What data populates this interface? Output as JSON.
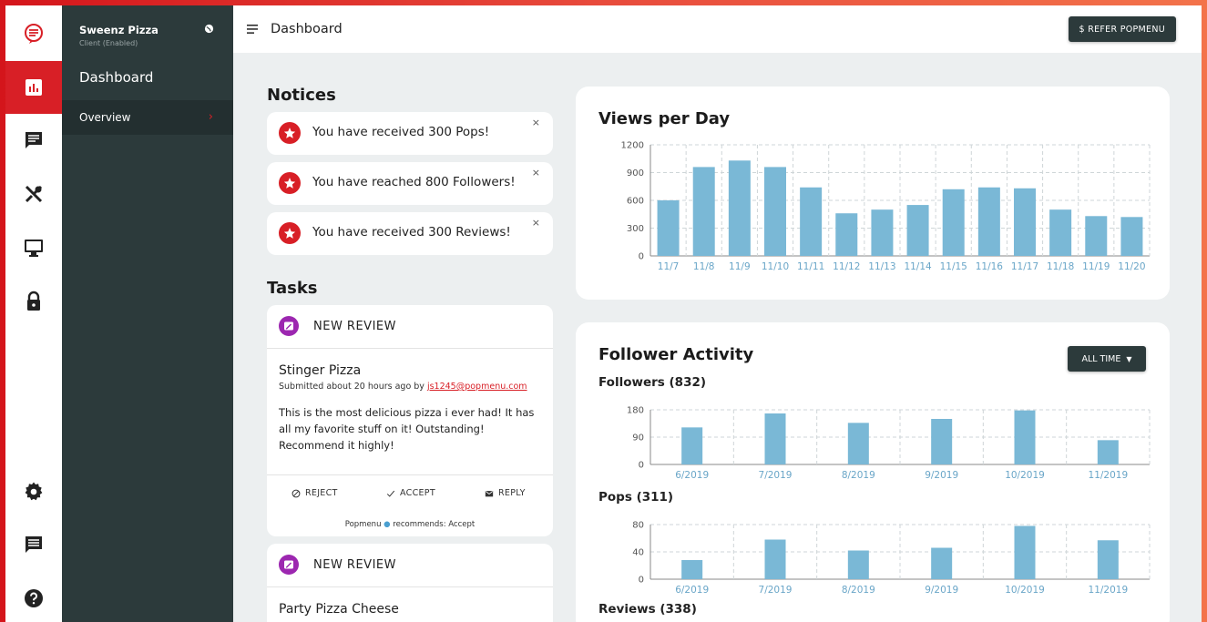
{
  "app": {
    "client_name": "Sweenz Pizza",
    "client_status": "Client (Enabled)",
    "nav_dashboard": "Dashboard",
    "nav_overview": "Overview",
    "page_title": "Dashboard",
    "refer_button": "$ REFER POPMENU"
  },
  "rail_icons": [
    "chat-bubble-logo-icon",
    "bar-chart-icon",
    "message-icon",
    "utensils-icon",
    "monitor-icon",
    "lock-icon",
    "gear-icon",
    "feedback-icon",
    "help-icon"
  ],
  "notices": {
    "heading": "Notices",
    "items": [
      {
        "text": "You have received 300 Pops!",
        "close": "×"
      },
      {
        "text": "You have reached 800 Followers!",
        "close": "×"
      },
      {
        "text": "You have received 300 Reviews!",
        "close": "×"
      }
    ]
  },
  "tasks": {
    "heading": "Tasks",
    "items": [
      {
        "type": "NEW REVIEW",
        "restaurant": "Stinger Pizza",
        "submitted_prefix": "Submitted about 20 hours ago by ",
        "submitted_by": "js1245@popmenu.com",
        "review": "This is the most delicious pizza i ever had! It has all my favorite stuff on it! Outstanding! Recommend it highly!",
        "reject": "REJECT",
        "accept": "ACCEPT",
        "reply": "REPLY",
        "recommend_prefix": "Popmenu",
        "recommend_suffix": "recommends: Accept"
      },
      {
        "type": "NEW REVIEW",
        "restaurant": "Party Pizza Cheese"
      }
    ]
  },
  "colors": {
    "accent": "#d81f26",
    "bar": "#7ab8d6",
    "sidebar": "#2c3a3b",
    "task_badge": "#9c27b0"
  },
  "chart_data": [
    {
      "type": "bar",
      "title": "Views per Day",
      "categories": [
        "11/7",
        "11/8",
        "11/9",
        "11/10",
        "11/11",
        "11/12",
        "11/13",
        "11/14",
        "11/15",
        "11/16",
        "11/17",
        "11/18",
        "11/19",
        "11/20"
      ],
      "values": [
        600,
        960,
        1030,
        960,
        740,
        460,
        500,
        550,
        720,
        740,
        730,
        500,
        430,
        420
      ],
      "ylim": [
        0,
        1200
      ],
      "yticks": [
        0,
        300,
        600,
        900,
        1200
      ],
      "grid": true
    },
    {
      "type": "bar",
      "title": "Follower Activity",
      "filter": "ALL TIME",
      "subcharts": [
        {
          "title": "Followers (832)",
          "categories": [
            "6/2019",
            "7/2019",
            "8/2019",
            "9/2019",
            "10/2019",
            "11/2019"
          ],
          "values": [
            122,
            168,
            137,
            150,
            178,
            80
          ],
          "ylim": [
            0,
            180
          ],
          "yticks": [
            0,
            90,
            180
          ]
        },
        {
          "title": "Pops (311)",
          "categories": [
            "6/2019",
            "7/2019",
            "8/2019",
            "9/2019",
            "10/2019",
            "11/2019"
          ],
          "values": [
            28,
            58,
            42,
            46,
            78,
            57
          ],
          "ylim": [
            0,
            80
          ],
          "yticks": [
            0,
            40,
            80
          ]
        },
        {
          "title": "Reviews (338)"
        }
      ]
    }
  ]
}
